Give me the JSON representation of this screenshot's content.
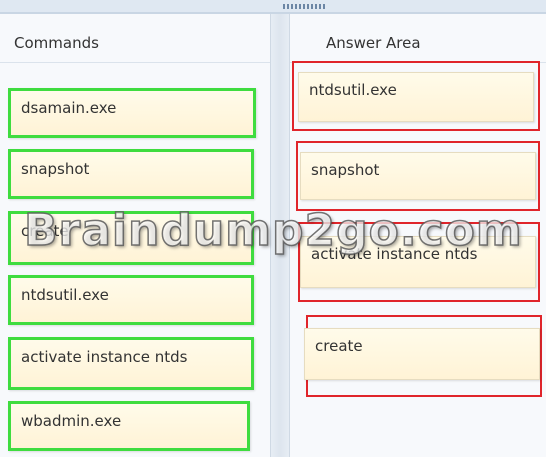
{
  "commands_panel": {
    "title": "Commands",
    "items": [
      {
        "label": "dsamain.exe"
      },
      {
        "label": "snapshot"
      },
      {
        "label": "create"
      },
      {
        "label": "ntdsutil.exe"
      },
      {
        "label": "activate instance ntds"
      },
      {
        "label": "wbadmin.exe"
      }
    ]
  },
  "answer_panel": {
    "title": "Answer Area",
    "slots": [
      {
        "label": "ntdsutil.exe"
      },
      {
        "label": "snapshot"
      },
      {
        "label": "activate instance ntds"
      },
      {
        "label": "create"
      }
    ]
  },
  "watermark": "Braindump2go.com",
  "colors": {
    "command_border": "#3fdc3f",
    "answer_border": "#e0252b",
    "card_fill": "#fff6de"
  }
}
